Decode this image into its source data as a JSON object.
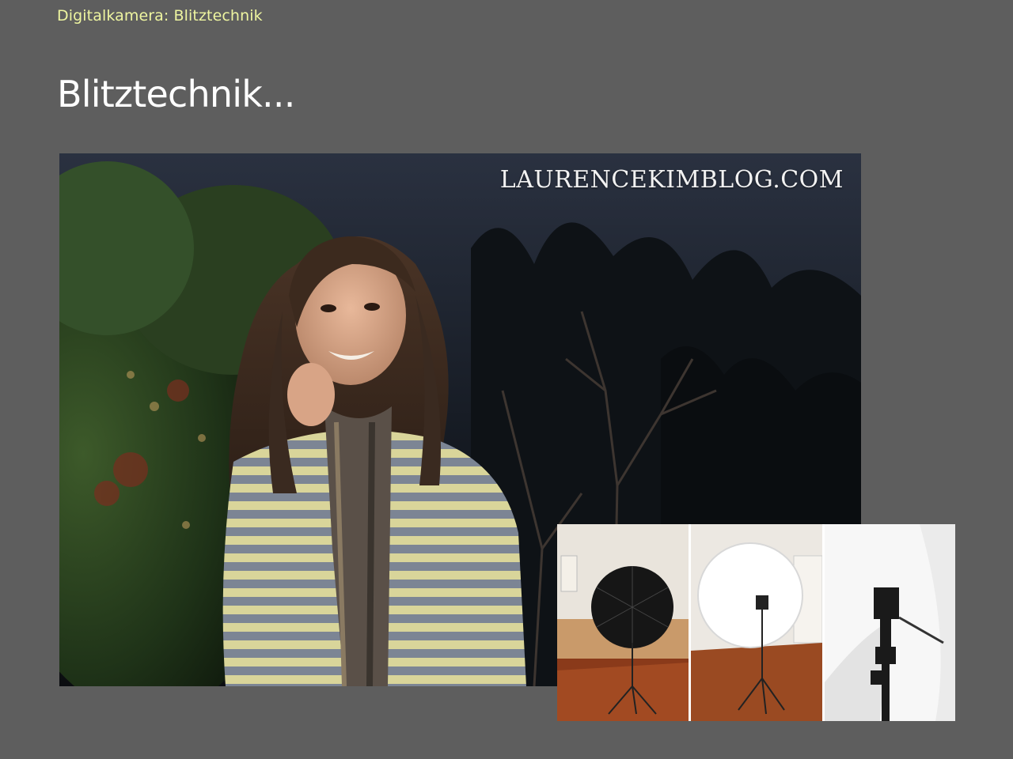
{
  "slide": {
    "header": "Digitalkamera: Blitztechnik",
    "title": "Blitztechnik..."
  },
  "main_photo": {
    "watermark": "LAURENCEKIMBLOG.COM"
  },
  "setup_strip": {
    "panels": [
      "black umbrella",
      "white umbrella",
      "flash on stand"
    ]
  },
  "colors": {
    "background": "#5e5e5e",
    "header": "#eef5a0",
    "title": "#ffffff"
  }
}
